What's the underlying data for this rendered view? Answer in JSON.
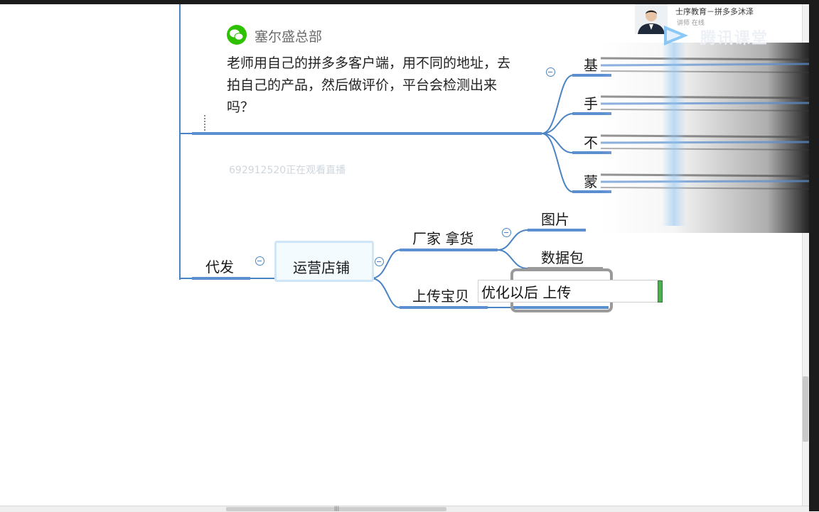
{
  "comment": {
    "author": "塞尔盛总部",
    "message": "老师用自己的拼多多客户端，用不同的地址，去拍自己的产品，然后做评价，平台会检测出来吗？",
    "watch_note": "692912520正在观看直播"
  },
  "mindmap": {
    "branch_right_items": [
      "基",
      "手",
      "不",
      "蒙"
    ],
    "root_branch": "代发",
    "selected_node": "运营店铺",
    "child_1": "厂家  拿货",
    "child_1_items": [
      "图片",
      "数据包"
    ],
    "child_2": "上传宝贝",
    "editing_value": "优化以后 上传"
  },
  "stream_overlay": {
    "presenter_title": "士序教育－拼多多沐泽",
    "presenter_sub": "讲师  在线",
    "brand": "腾讯课堂"
  },
  "colors": {
    "branch_line": "#4a84c4",
    "underline": "#5b8fd0",
    "selection": "#cfe6f8",
    "edit_frame": "#9a9a9a",
    "wechat_green": "#2dc100"
  },
  "icons": {
    "avatar": "wechat-icon",
    "collapse": "minus-circle-icon",
    "brand_logo": "play-icon"
  }
}
